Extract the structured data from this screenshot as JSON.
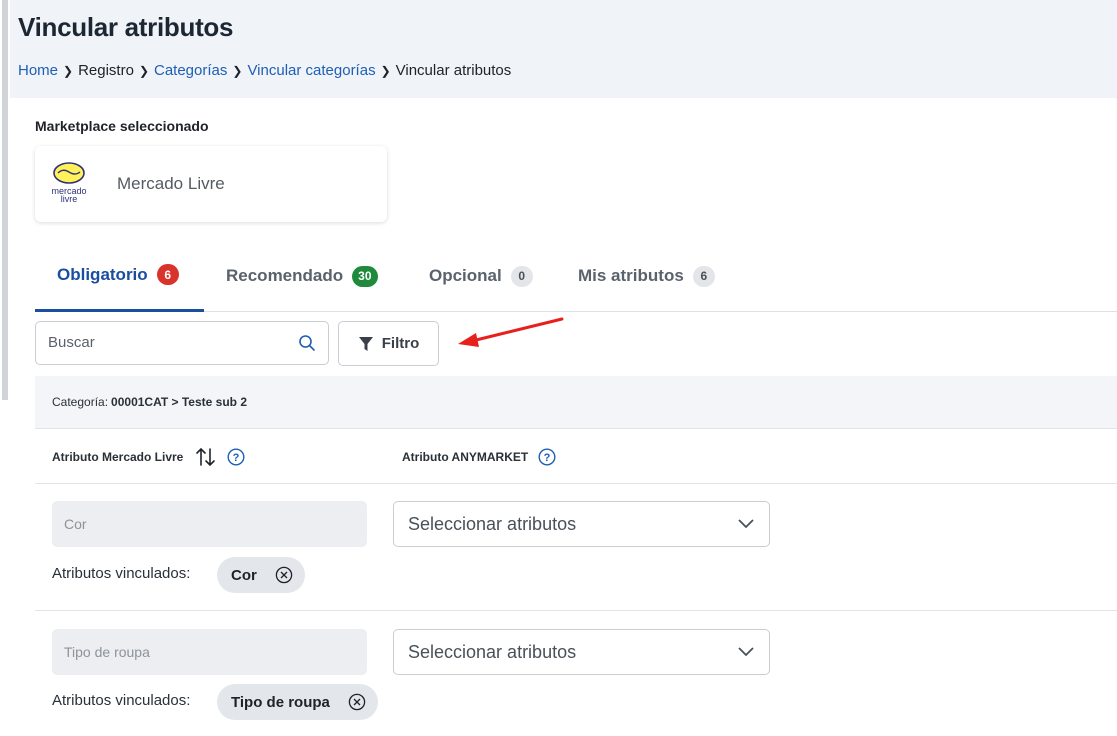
{
  "page": {
    "title": "Vincular atributos",
    "breadcrumb": [
      "Home",
      "Registro",
      "Categorías",
      "Vincular categorías",
      "Vincular atributos"
    ]
  },
  "marketplace": {
    "label": "Marketplace seleccionado",
    "logo_text_top": "mercado",
    "logo_text_bottom": "livre",
    "name": "Mercado Livre"
  },
  "tabs": [
    {
      "label": "Obligatorio",
      "count": "6",
      "badge_color": "red",
      "active": true
    },
    {
      "label": "Recomendado",
      "count": "30",
      "badge_color": "green",
      "active": false
    },
    {
      "label": "Opcional",
      "count": "0",
      "badge_color": "grey",
      "active": false
    },
    {
      "label": "Mis atributos",
      "count": "6",
      "badge_color": "grey",
      "active": false
    }
  ],
  "search": {
    "placeholder": "Buscar"
  },
  "filter": {
    "label": "Filtro"
  },
  "category": {
    "label": "Categoría:",
    "value": "00001CAT > Teste sub 2"
  },
  "columns": {
    "ml": "Atributo Mercado Livre",
    "anymarket": "Atributo ANYMARKET"
  },
  "rows": [
    {
      "attribute": "Cor",
      "select_placeholder": "Seleccionar atributos",
      "linked_label": "Atributos vinculados:",
      "chip": "Cor"
    },
    {
      "attribute": "Tipo de roupa",
      "select_placeholder": "Seleccionar atributos",
      "linked_label": "Atributos vinculados:",
      "chip": "Tipo de roupa"
    }
  ],
  "colors": {
    "accent": "#1a4fa0",
    "link": "#1e5fb4",
    "header_bg": "#f0f3f8",
    "annotation_arrow": "#e8201c"
  }
}
